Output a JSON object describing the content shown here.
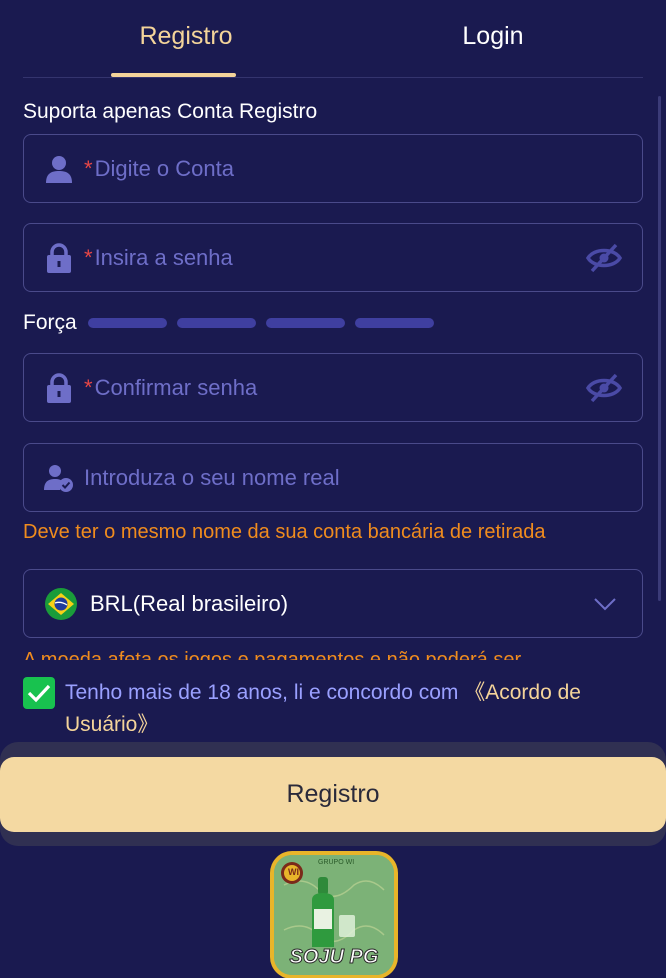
{
  "tabs": {
    "register": "Registro",
    "login": "Login"
  },
  "support_text": "Suporta apenas Conta Registro",
  "account": {
    "required": "*",
    "placeholder": "Digite o Conta"
  },
  "password": {
    "required": "*",
    "placeholder": "Insira a senha"
  },
  "strength": {
    "label": "Força",
    "levels": 4
  },
  "confirm": {
    "required": "*",
    "placeholder": "Confirmar senha"
  },
  "realname": {
    "placeholder": "Introduza o seu nome real"
  },
  "realname_hint": "Deve ter o mesmo nome da sua conta bancária de retirada",
  "currency": {
    "selected": "BRL(Real brasileiro)"
  },
  "currency_hint": "A moeda afeta os jogos e pagamentos e não poderá ser",
  "agreement": {
    "text": "Tenho mais de 18 anos, li e concordo com ",
    "link": "《Acordo de Usuário》",
    "checked": true
  },
  "submit_label": "Registro",
  "logo": {
    "brand_text": "SOJU PG",
    "top_text": "GRUPO WI",
    "badge": "WI"
  },
  "colors": {
    "background": "#1a1a50",
    "accent": "#f4d49a",
    "hint": "#f08c1e",
    "check": "#18c24f"
  },
  "icons": [
    "user-icon",
    "lock-icon",
    "eye-off-icon",
    "user-check-icon",
    "brazil-flag-icon",
    "chevron-down-icon",
    "check-icon"
  ]
}
